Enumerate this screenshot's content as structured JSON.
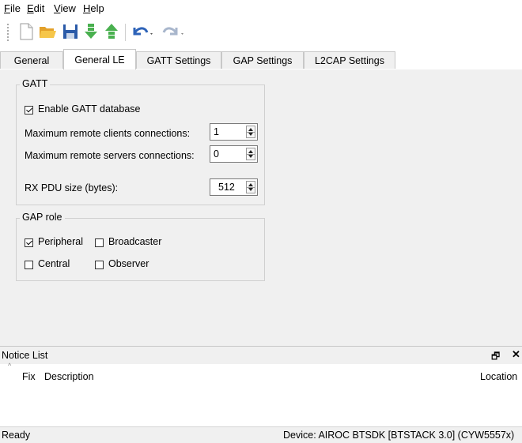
{
  "menu": {
    "items": [
      {
        "label": "File",
        "mnemonic": "F",
        "rest": "ile"
      },
      {
        "label": "Edit",
        "mnemonic": "E",
        "rest": "dit"
      },
      {
        "label": "View",
        "mnemonic": "V",
        "rest": "iew"
      },
      {
        "label": "Help",
        "mnemonic": "H",
        "rest": "elp"
      }
    ]
  },
  "toolbar": {
    "icons": [
      "new-file-icon",
      "open-folder-icon",
      "save-icon",
      "import-icon",
      "export-icon",
      "undo-icon",
      "redo-icon"
    ]
  },
  "tabs": [
    {
      "label": "General",
      "active": false
    },
    {
      "label": "General LE",
      "active": true
    },
    {
      "label": "GATT Settings",
      "active": false
    },
    {
      "label": "GAP Settings",
      "active": false
    },
    {
      "label": "L2CAP Settings",
      "active": false
    }
  ],
  "gatt": {
    "title": "GATT",
    "enable_label": "Enable GATT database",
    "enable_checked": true,
    "max_clients_label": "Maximum remote clients connections:",
    "max_clients_value": "1",
    "max_servers_label": "Maximum remote servers connections:",
    "max_servers_value": "0",
    "rx_pdu_label": "RX PDU size (bytes):",
    "rx_pdu_value": "512"
  },
  "gap_role": {
    "title": "GAP role",
    "peripheral_label": "Peripheral",
    "peripheral_checked": true,
    "broadcaster_label": "Broadcaster",
    "broadcaster_checked": false,
    "central_label": "Central",
    "central_checked": false,
    "observer_label": "Observer",
    "observer_checked": false
  },
  "notice": {
    "title": "Notice List",
    "columns": [
      "Fix",
      "Description",
      "Location"
    ]
  },
  "status": {
    "left": "Ready",
    "right": "Device: AIROC BTSDK [BTSTACK 3.0] (CYW5557x)"
  },
  "colors": {
    "accent_blue": "#1f5fb4",
    "toolbar_green": "#3aa64a",
    "folder_yellow": "#f2b83a"
  }
}
